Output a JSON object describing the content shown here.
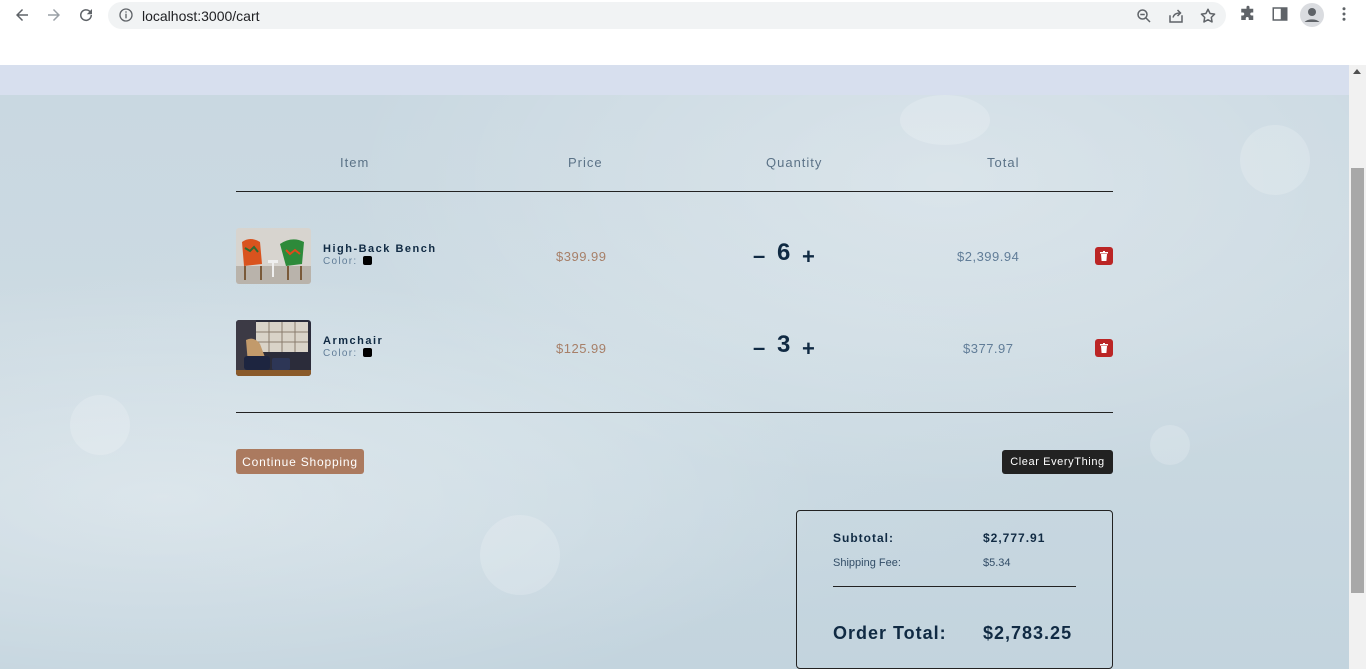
{
  "browser": {
    "url": "localhost:3000/cart"
  },
  "cart": {
    "headers": {
      "item": "Item",
      "price": "Price",
      "quantity": "Quantity",
      "total": "Total"
    },
    "items": [
      {
        "name": "High-Back Bench",
        "color_label": "Color:",
        "color": "#000000",
        "price": "$399.99",
        "quantity": "6",
        "minus": "–",
        "plus": "+",
        "subtotal": "$2,399.94"
      },
      {
        "name": "Armchair",
        "color_label": "Color:",
        "color": "#000000",
        "price": "$125.99",
        "quantity": "3",
        "minus": "–",
        "plus": "+",
        "subtotal": "$377.97"
      }
    ],
    "continue_label": "Continue Shopping",
    "clear_label": "Clear EveryThing",
    "totals": {
      "subtotal_label": "Subtotal:",
      "subtotal_value": "$2,777.91",
      "shipping_label": "Shipping Fee:",
      "shipping_value": "$5.34",
      "order_label": "Order Total:",
      "order_value": "$2,783.25"
    }
  },
  "colors": {
    "accent": "#ab7a5f",
    "danger": "#bb2525",
    "dark": "#222222",
    "navbar": "#d7dfee"
  },
  "icons": [
    "back-icon",
    "forward-icon",
    "reload-icon",
    "info-icon",
    "zoom-icon",
    "share-icon",
    "star-icon",
    "extensions-icon",
    "side-panel-icon",
    "profile-icon",
    "menu-icon",
    "trash-icon"
  ]
}
